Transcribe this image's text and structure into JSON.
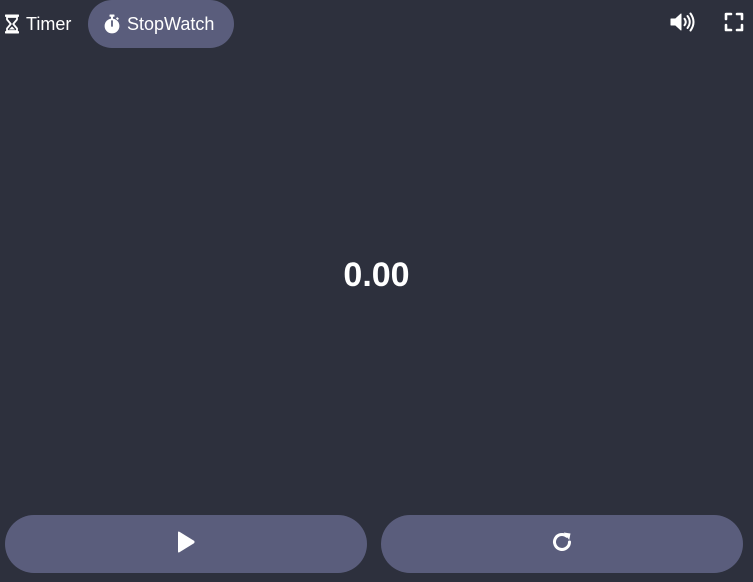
{
  "tabs": {
    "timer_label": "Timer",
    "stopwatch_label": "StopWatch",
    "active": "stopwatch"
  },
  "display": {
    "time": "0.00"
  },
  "icons": {
    "timer": "hourglass-icon",
    "stopwatch": "stopwatch-icon",
    "volume": "volume-icon",
    "fullscreen": "fullscreen-icon",
    "play": "play-icon",
    "reset": "reset-icon"
  },
  "colors": {
    "background": "#2d303d",
    "accent": "#5a5d7c",
    "text": "#ffffff"
  }
}
